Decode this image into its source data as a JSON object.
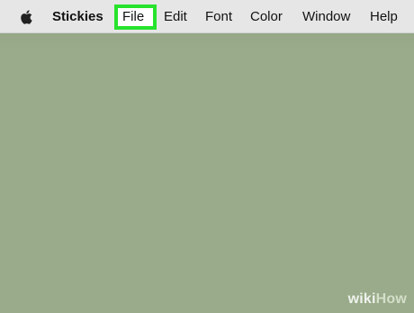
{
  "menubar": {
    "apple_icon": "apple-logo-icon",
    "app_name": "Stickies",
    "items": [
      {
        "label": "File",
        "highlighted": true
      },
      {
        "label": "Edit"
      },
      {
        "label": "Font"
      },
      {
        "label": "Color"
      },
      {
        "label": "Window"
      },
      {
        "label": "Help"
      }
    ]
  },
  "colors": {
    "menubar": "#e6e6e6",
    "desktop": "#99ab8a",
    "highlight": "#27e32d"
  },
  "watermark": {
    "part1": "wiki",
    "part2": "How"
  }
}
